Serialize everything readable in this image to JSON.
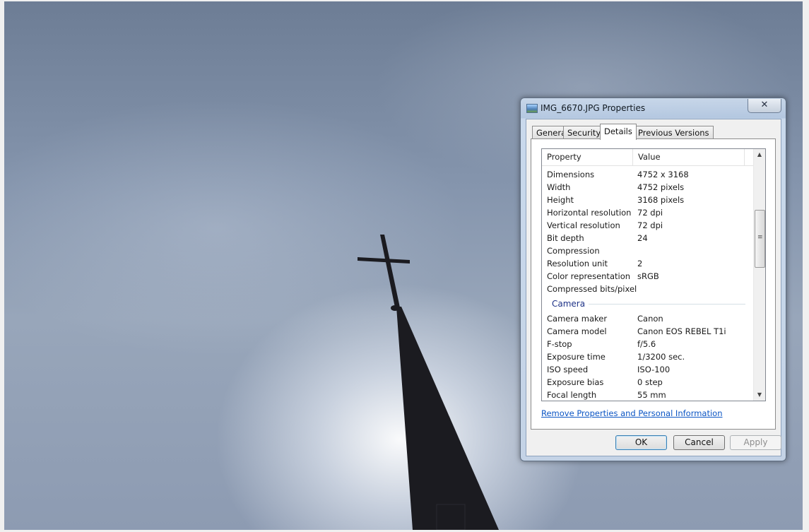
{
  "window": {
    "title": "IMG_6670.JPG Properties",
    "close_glyph": "✕"
  },
  "tabs": [
    {
      "label": "General"
    },
    {
      "label": "Security"
    },
    {
      "label": "Details"
    },
    {
      "label": "Previous Versions"
    }
  ],
  "active_tab": "Details",
  "list": {
    "columns": {
      "property": "Property",
      "value": "Value"
    },
    "image_rows": [
      {
        "k": "Dimensions",
        "v": "4752 x 3168"
      },
      {
        "k": "Width",
        "v": "4752 pixels"
      },
      {
        "k": "Height",
        "v": "3168 pixels"
      },
      {
        "k": "Horizontal resolution",
        "v": "72 dpi"
      },
      {
        "k": "Vertical resolution",
        "v": "72 dpi"
      },
      {
        "k": "Bit depth",
        "v": "24"
      },
      {
        "k": "Compression",
        "v": ""
      },
      {
        "k": "Resolution unit",
        "v": "2"
      },
      {
        "k": "Color representation",
        "v": "sRGB"
      },
      {
        "k": "Compressed bits/pixel",
        "v": ""
      }
    ],
    "camera_group": "Camera",
    "camera_rows": [
      {
        "k": "Camera maker",
        "v": "Canon"
      },
      {
        "k": "Camera model",
        "v": "Canon EOS REBEL T1i"
      },
      {
        "k": "F-stop",
        "v": "f/5.6"
      },
      {
        "k": "Exposure time",
        "v": "1/3200 sec."
      },
      {
        "k": "ISO speed",
        "v": "ISO-100"
      },
      {
        "k": "Exposure bias",
        "v": "0 step"
      },
      {
        "k": "Focal length",
        "v": "55 mm"
      }
    ]
  },
  "scrollbar": {
    "up": "▲",
    "down": "▼",
    "grip": "≡"
  },
  "remove_link": "Remove Properties and Personal Information",
  "buttons": {
    "ok": "OK",
    "cancel": "Cancel",
    "apply": "Apply"
  },
  "colors": {
    "link": "#0b55c4",
    "group_heading": "#1e3287"
  }
}
